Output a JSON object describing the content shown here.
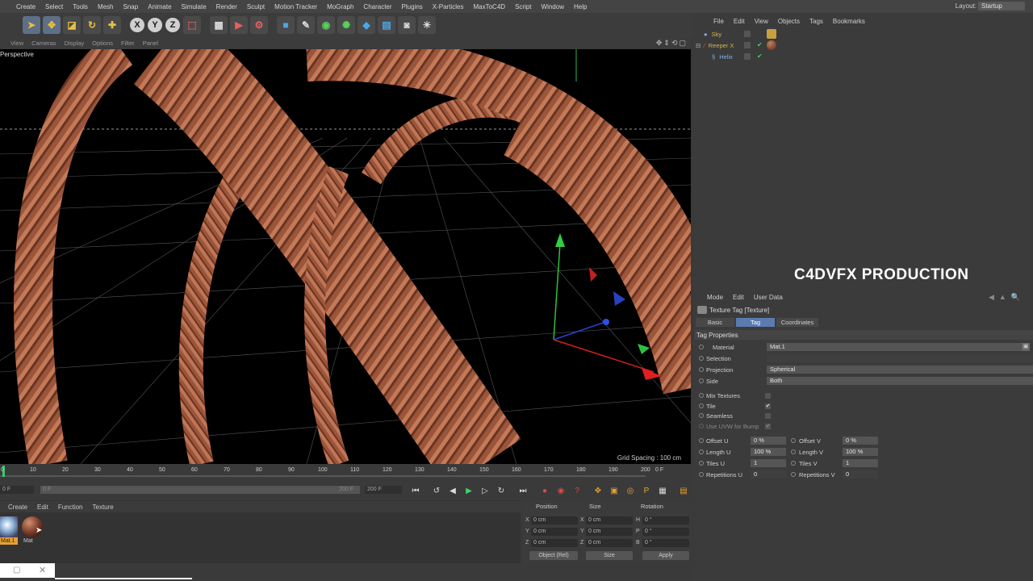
{
  "menubar": {
    "items": [
      "Create",
      "Select",
      "Tools",
      "Mesh",
      "Snap",
      "Animate",
      "Simulate",
      "Render",
      "Sculpt",
      "Motion Tracker",
      "MoGraph",
      "Character",
      "Plugins",
      "X-Particles",
      "MaxToC4D",
      "Script",
      "Window",
      "Help"
    ],
    "layout_label": "Layout:",
    "layout_value": "Startup"
  },
  "viewport": {
    "menu": [
      "View",
      "Cameras",
      "Display",
      "Options",
      "Filter",
      "Panel"
    ],
    "label": "Perspective",
    "grid_spacing": "Grid Spacing : 100 cm"
  },
  "timeline": {
    "ticks": [
      "0",
      "10",
      "20",
      "30",
      "40",
      "50",
      "60",
      "70",
      "80",
      "90",
      "100",
      "110",
      "120",
      "130",
      "140",
      "150",
      "160",
      "170",
      "180",
      "190",
      "200"
    ],
    "current_frame": "0 F",
    "start_field": "0 F",
    "start_field2": "0 F",
    "end_field": "200 F",
    "end_field2": "200 F"
  },
  "materials": {
    "menu": [
      "Create",
      "Edit",
      "Function",
      "Texture"
    ],
    "items": [
      {
        "label": "Mat.1"
      },
      {
        "label": "Mat"
      }
    ]
  },
  "coordinates": {
    "headers": {
      "position": "Position",
      "size": "Size",
      "rotation": "Rotation"
    },
    "rows": [
      {
        "axis": "X",
        "pos": "0 cm",
        "saxis": "X",
        "size": "0 cm",
        "raxis": "H",
        "rot": "0 °"
      },
      {
        "axis": "Y",
        "pos": "0 cm",
        "saxis": "Y",
        "size": "0 cm",
        "raxis": "P",
        "rot": "0 °"
      },
      {
        "axis": "Z",
        "pos": "0 cm",
        "saxis": "Z",
        "size": "0 cm",
        "raxis": "B",
        "rot": "0 °"
      }
    ],
    "mode_select": "Object (Rel)",
    "size_select": "Size",
    "apply": "Apply"
  },
  "objects": {
    "menu": [
      "File",
      "Edit",
      "View",
      "Objects",
      "Tags",
      "Bookmarks"
    ],
    "items": [
      {
        "name": "Sky",
        "color": "#d4b44a"
      },
      {
        "name": "Reeper X",
        "color": "#d4b44a"
      },
      {
        "name": "Helix",
        "color": "#7fb0e8"
      }
    ]
  },
  "watermark": "C4DVFX PRODUCTION",
  "attributes": {
    "menu": [
      "Mode",
      "Edit",
      "User Data"
    ],
    "title": "Texture Tag [Texture]",
    "tabs": [
      "Basic",
      "Tag",
      "Coordinates"
    ],
    "active_tab": "Tag",
    "section": "Tag Properties",
    "props": [
      {
        "label": "Material",
        "value": "Mat.1"
      },
      {
        "label": "Selection",
        "value": ""
      },
      {
        "label": "Projection",
        "value": "Spherical"
      },
      {
        "label": "Side",
        "value": "Both"
      }
    ],
    "checks": [
      {
        "label": "Mix Textures",
        "checked": ""
      },
      {
        "label": "Tile",
        "checked": "✔"
      },
      {
        "label": "Seamless",
        "checked": ""
      },
      {
        "label": "Use UVW for Bump",
        "checked": "✔"
      }
    ],
    "uv": [
      {
        "l1": "Offset U",
        "v1": "0 %",
        "l2": "Offset V",
        "v2": "0 %"
      },
      {
        "l1": "Length U",
        "v1": "100 %",
        "l2": "Length V",
        "v2": "100 %"
      },
      {
        "l1": "Tiles U",
        "v1": "1",
        "l2": "Tiles V",
        "v2": "1"
      },
      {
        "l1": "Repetitions U",
        "v1": "0",
        "l2": "Repetitions V",
        "v2": "0"
      }
    ]
  },
  "colors": {
    "accent": "#5a7bb0",
    "rope": "#a05a3c",
    "timeline_marker": "#36c96b"
  }
}
